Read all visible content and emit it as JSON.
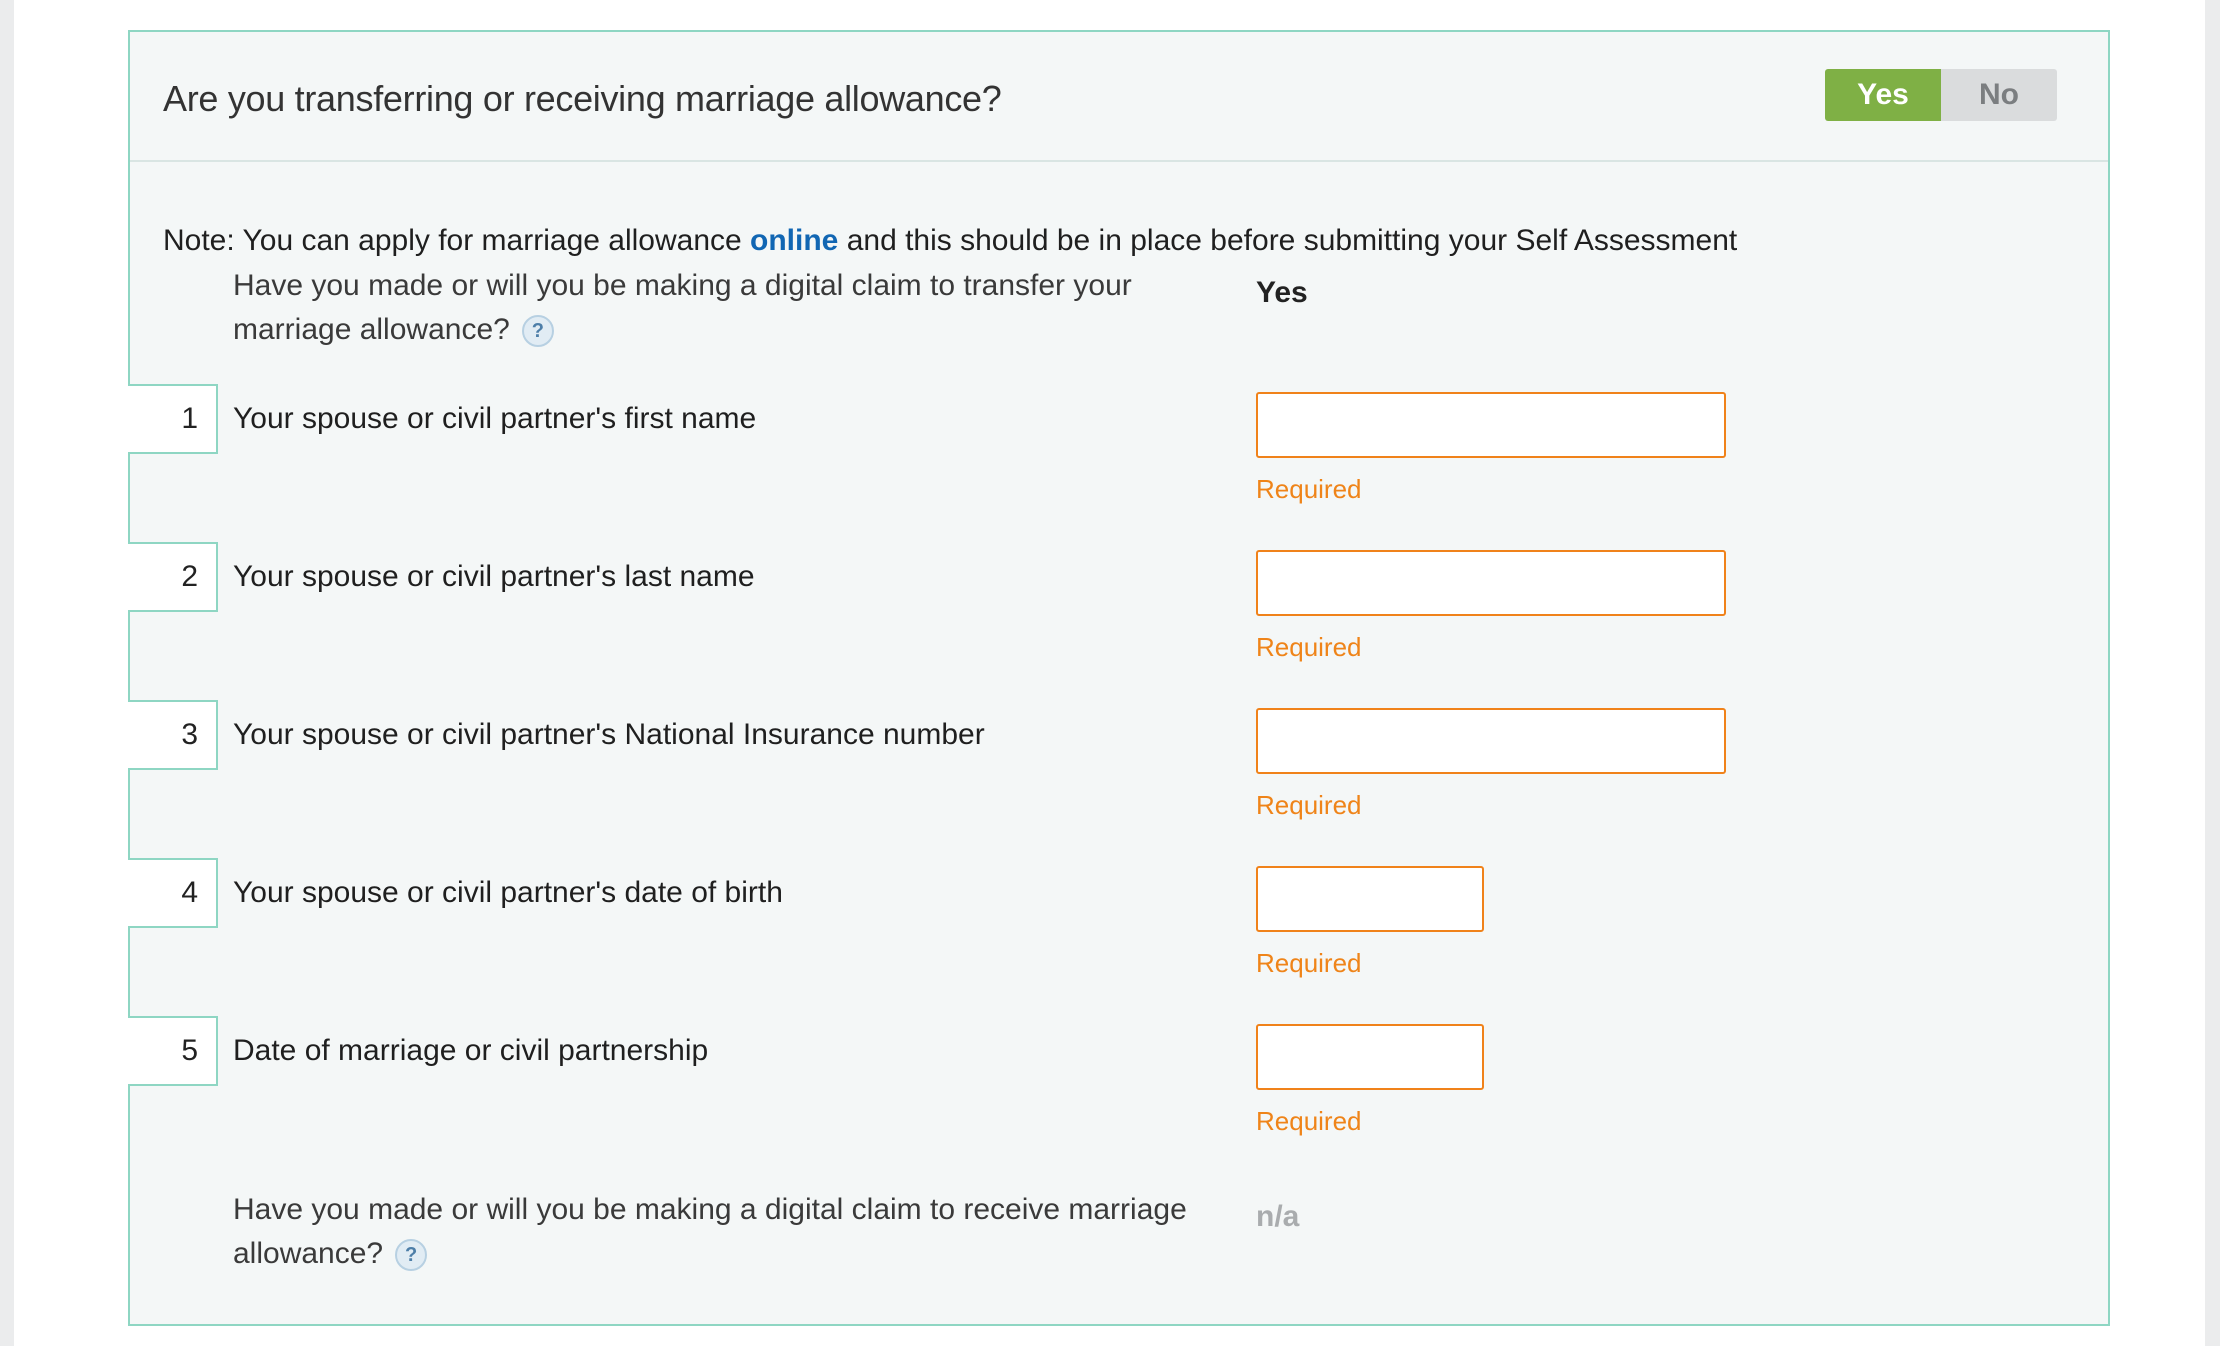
{
  "section": {
    "title": "Are you transferring or receiving marriage allowance?",
    "toggle": {
      "yes_label": "Yes",
      "no_label": "No",
      "selected": "Yes"
    }
  },
  "note": {
    "prefix": "Note: You can apply for marriage allowance ",
    "link_label": "online",
    "suffix": " and this should be in place before submitting your Self Assessment"
  },
  "transfer_claim": {
    "question_line1": "Have you made or will you be making a digital claim to transfer your",
    "question_line2": "marriage allowance?",
    "help_glyph": "?",
    "answer": "Yes"
  },
  "fields": [
    {
      "number": "1",
      "label": "Your spouse or civil partner's first name",
      "value": "",
      "required_text": "Required"
    },
    {
      "number": "2",
      "label": "Your spouse or civil partner's last name",
      "value": "",
      "required_text": "Required"
    },
    {
      "number": "3",
      "label": "Your spouse or civil partner's National Insurance number",
      "value": "",
      "required_text": "Required"
    },
    {
      "number": "4",
      "label": "Your spouse or civil partner's date of birth",
      "value": "",
      "required_text": "Required"
    },
    {
      "number": "5",
      "label": "Date of marriage or civil partnership",
      "value": "",
      "required_text": "Required"
    }
  ],
  "receive_claim": {
    "question_line1": "Have you made or will you be making a digital claim to receive marriage",
    "question_line2": "allowance?",
    "help_glyph": "?",
    "answer": "n/a"
  },
  "colors": {
    "accent_green": "#7fb045",
    "link_blue": "#1166b3",
    "required_orange": "#ef8419",
    "panel_border": "#8ed6c3"
  }
}
